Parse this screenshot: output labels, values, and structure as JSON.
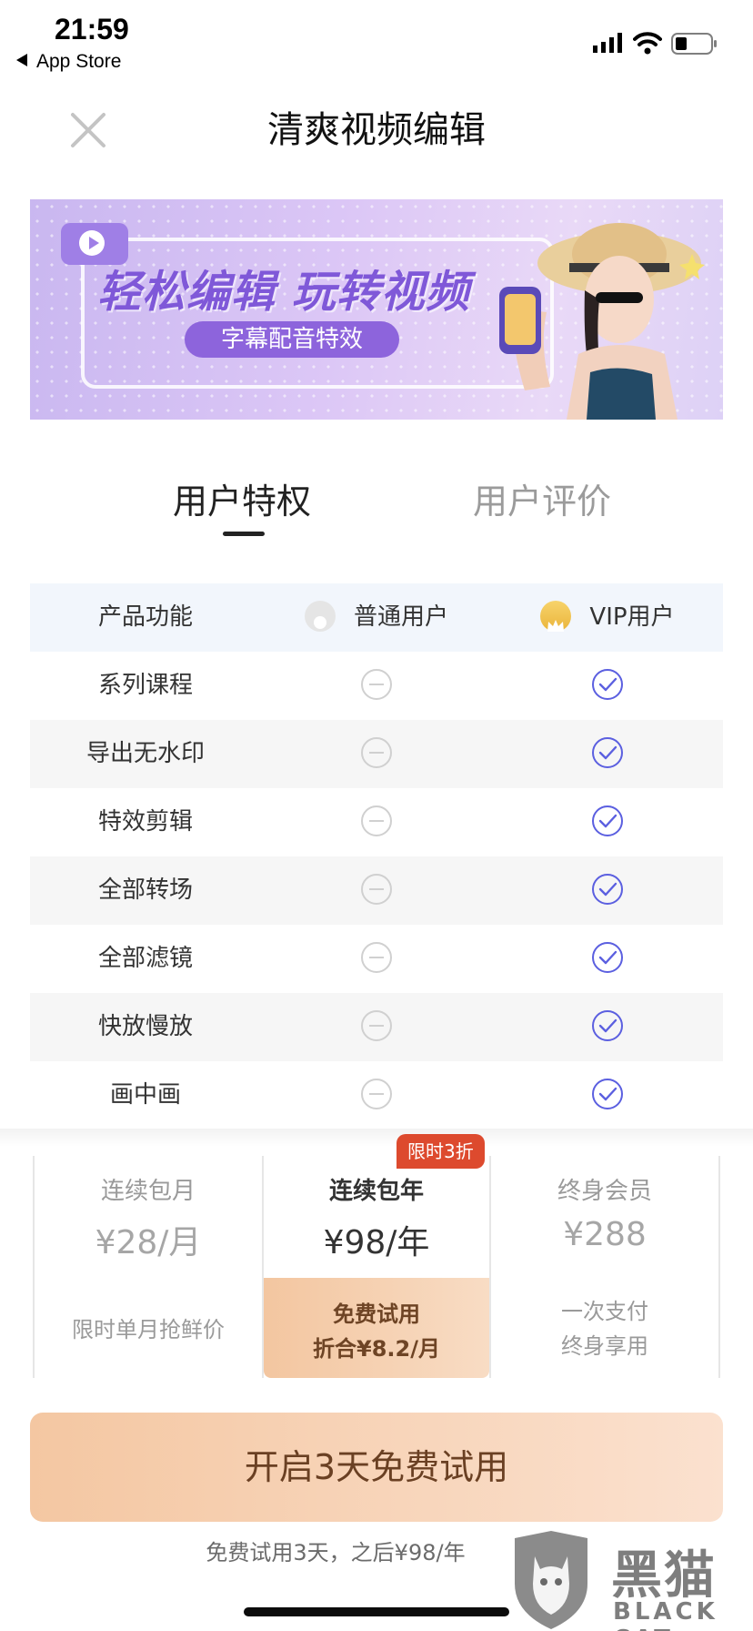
{
  "status_bar": {
    "time": "21:59",
    "back_label": "App Store"
  },
  "header": {
    "title": "清爽视频编辑"
  },
  "banner": {
    "headline": "轻松编辑 玩转视频",
    "pill": "字幕配音特效"
  },
  "tabs": [
    {
      "label": "用户特权",
      "active": true
    },
    {
      "label": "用户评价",
      "active": false
    }
  ],
  "table": {
    "headers": {
      "feature": "产品功能",
      "normal": "普通用户",
      "vip": "VIP用户"
    },
    "rows": [
      {
        "feature": "系列课程",
        "normal": "unavailable",
        "vip": "available"
      },
      {
        "feature": "导出无水印",
        "normal": "unavailable",
        "vip": "available"
      },
      {
        "feature": "特效剪辑",
        "normal": "unavailable",
        "vip": "available"
      },
      {
        "feature": "全部转场",
        "normal": "unavailable",
        "vip": "available"
      },
      {
        "feature": "全部滤镜",
        "normal": "unavailable",
        "vip": "available"
      },
      {
        "feature": "快放慢放",
        "normal": "unavailable",
        "vip": "available"
      },
      {
        "feature": "画中画",
        "normal": "unavailable",
        "vip": "available"
      }
    ]
  },
  "plans": {
    "badge": "限时3折",
    "items": [
      {
        "name": "连续包月",
        "price": "¥28/月",
        "note": "限时单月抢鲜价"
      },
      {
        "name": "连续包年",
        "price": "¥98/年",
        "note_line1": "免费试用",
        "note_line2": "折合¥8.2/月",
        "selected": true
      },
      {
        "name": "终身会员",
        "price": "¥288",
        "note_line1": "一次支付",
        "note_line2": "终身享用"
      }
    ]
  },
  "cta": {
    "label": "开启3天免费试用",
    "note": "免费试用3天，之后¥98/年"
  },
  "watermark": {
    "cn": "黑猫",
    "en": "BLACK CAT"
  },
  "colors": {
    "vip_check": "#5b5fe0",
    "cta_start": "#f4c7a2",
    "cta_end": "#fbe1cf",
    "badge": "#dd4a2e"
  }
}
